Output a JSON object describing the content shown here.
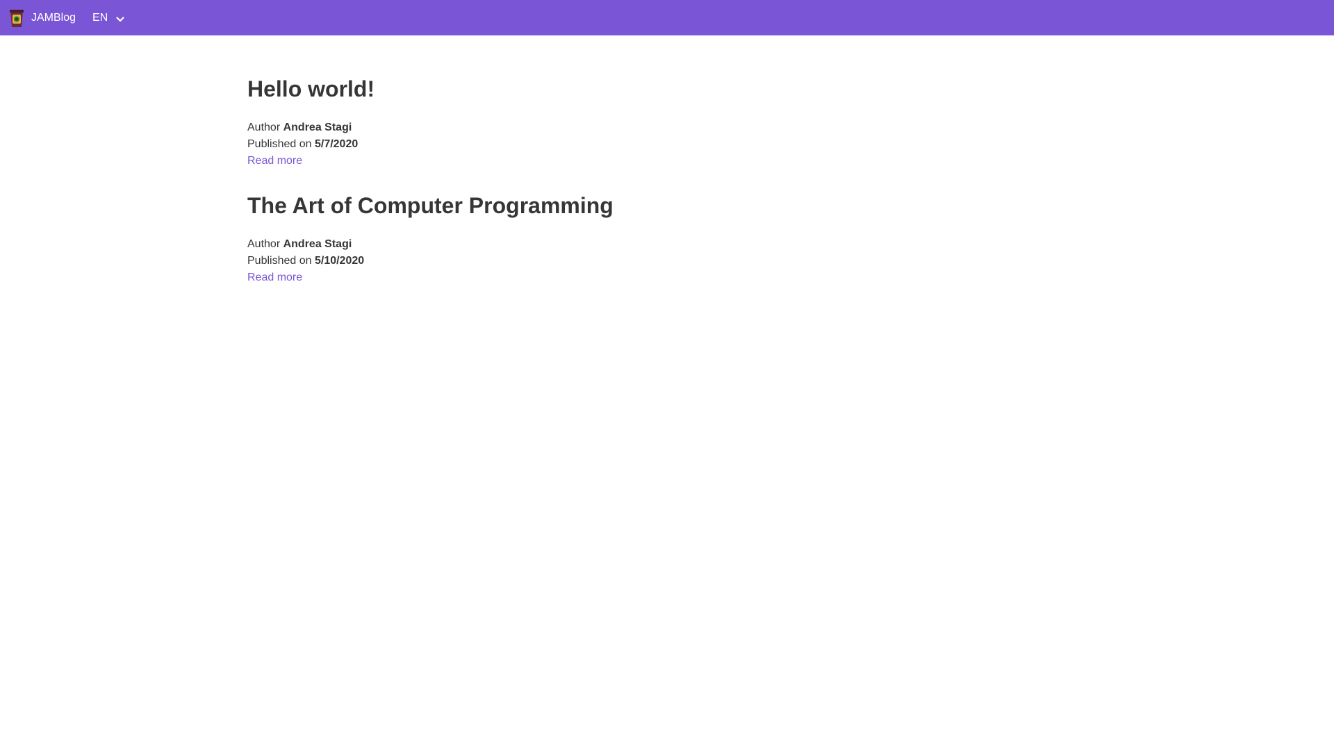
{
  "theme": {
    "primary": "#7a56d6",
    "nav_text": "#ffffff",
    "text": "#363636",
    "link": "#7a56d6"
  },
  "navbar": {
    "brand_name": "JAMBlog",
    "brand_icon": "coffee-cup-logo-icon",
    "language": {
      "selected": "EN",
      "icon": "chevron-down-icon"
    }
  },
  "posts": [
    {
      "title": "Hello world!",
      "author_label": "Author",
      "author": "Andrea Stagi",
      "published_label": "Published on",
      "date": "5/7/2020",
      "read_more": "Read more"
    },
    {
      "title": "The Art of Computer Programming",
      "author_label": "Author",
      "author": "Andrea Stagi",
      "published_label": "Published on",
      "date": "5/10/2020",
      "read_more": "Read more"
    }
  ]
}
